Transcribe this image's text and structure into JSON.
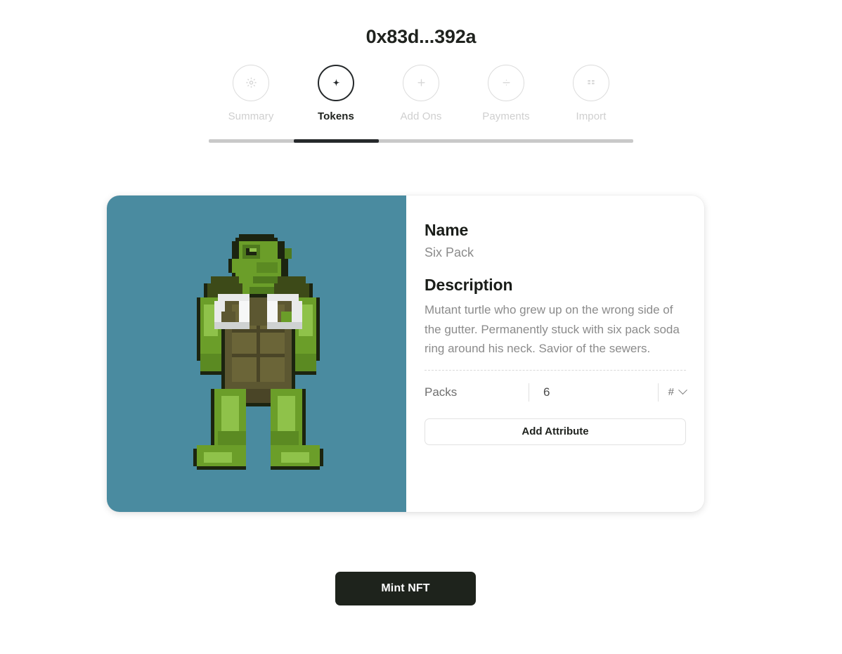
{
  "header": {
    "title": "0x83d...392a"
  },
  "nav": {
    "items": [
      {
        "label": "Summary",
        "icon": "gear-icon",
        "active": false
      },
      {
        "label": "Tokens",
        "icon": "sparkle-icon",
        "active": true
      },
      {
        "label": "Add Ons",
        "icon": "plus-icon",
        "active": false
      },
      {
        "label": "Payments",
        "icon": "divide-icon",
        "active": false
      },
      {
        "label": "Import",
        "icon": "grid-icon",
        "active": false
      }
    ],
    "progress_percent": 20,
    "progress_offset_percent": 20
  },
  "card": {
    "image": {
      "background_color": "#4a8ba0",
      "alt": "pixel-art mutant turtle character"
    },
    "name_label": "Name",
    "name_value": "Six Pack",
    "description_label": "Description",
    "description_value": "Mutant turtle who grew up on the wrong side of the gutter. Permanently stuck with six pack soda ring around his neck. Savior of the sewers.",
    "attributes": [
      {
        "name": "Packs",
        "value": "6",
        "type": "#"
      }
    ],
    "add_attribute_label": "Add Attribute"
  },
  "actions": {
    "mint_label": "Mint NFT"
  },
  "colors": {
    "accent_dark": "#1e231c",
    "image_bg": "#4a8ba0",
    "muted_text": "#8b8b8b",
    "inactive": "#cfcfcf"
  }
}
